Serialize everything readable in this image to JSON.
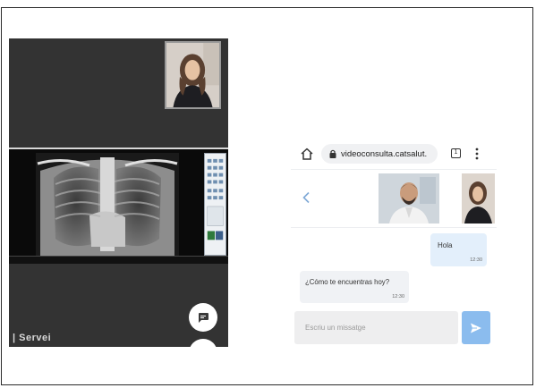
{
  "desktop": {
    "brand_text": "| Servei"
  },
  "browser": {
    "url": "videoconsulta.catsalut.",
    "tab_count": "1"
  },
  "chat": {
    "messages": [
      {
        "direction": "out",
        "text": "Hola",
        "time": "12:30"
      },
      {
        "direction": "in",
        "text": "¿Cómo te encuentras hoy?",
        "time": "12:30"
      }
    ],
    "input_placeholder": "Escriu un missatge"
  },
  "colors": {
    "send_button": "#8bbcee",
    "outgoing_bubble": "#e3effb",
    "incoming_bubble": "#f0f2f5",
    "desktop_background": "#333333"
  },
  "icons": [
    "home-icon",
    "lock-icon",
    "tabs-icon",
    "menu-icon",
    "back-icon",
    "send-icon",
    "chat-bubble-icon"
  ]
}
